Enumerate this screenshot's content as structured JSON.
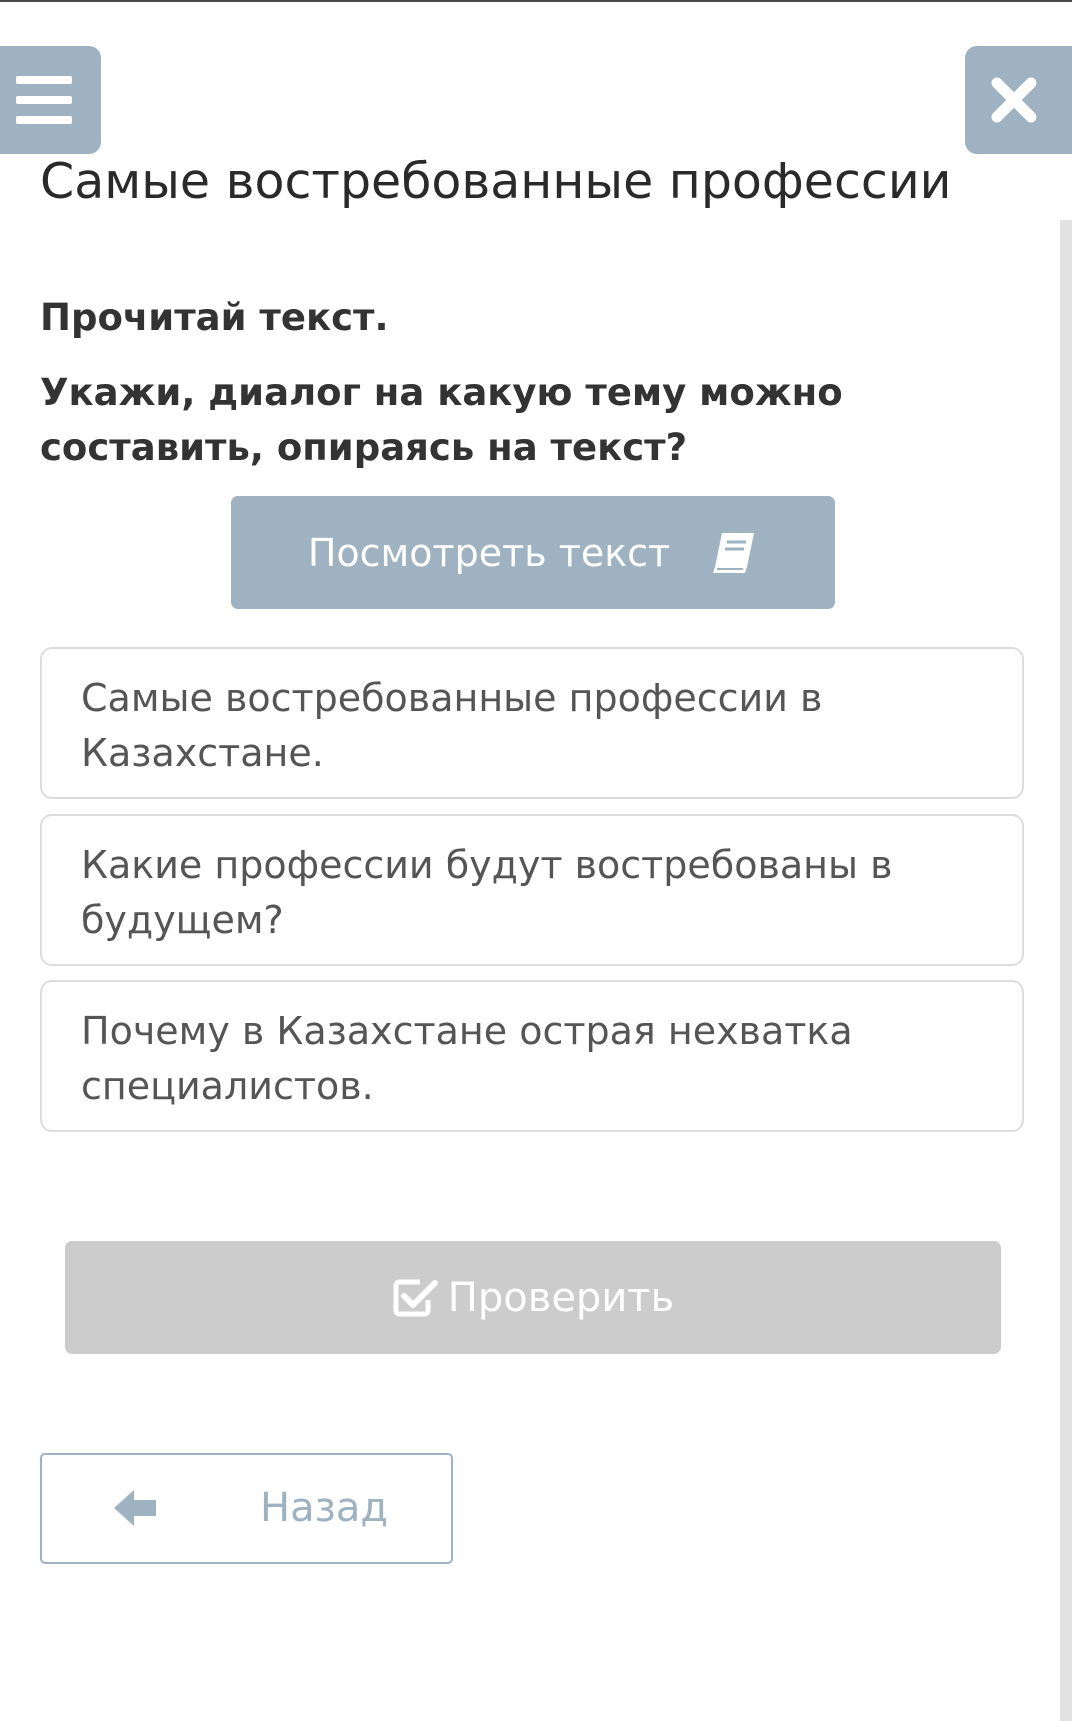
{
  "header": {
    "menu_icon": "hamburger-menu-icon",
    "close_icon": "close-x-icon",
    "title": "Самые востребованные профессии"
  },
  "task": {
    "instruction_1": "Прочитай текст.",
    "instruction_2": "Укажи, диалог на какую тему можно составить, опираясь на текст?",
    "view_text_label": "Посмотреть текст",
    "view_text_icon": "book-icon"
  },
  "options": [
    {
      "label": "Самые востребованные профессии в Казахстане."
    },
    {
      "label": "Какие профессии будут востребованы в будущем?"
    },
    {
      "label": "Почему в Казахстане острая нехватка специалистов."
    }
  ],
  "actions": {
    "check_label": "Проверить",
    "check_icon": "checkbox-check-icon",
    "back_label": "Назад",
    "back_icon": "arrow-left-icon"
  },
  "colors": {
    "accent": "#9eb2c1",
    "disabled": "#cccccc",
    "title_text": "#2a2a2a",
    "body_text": "#555555",
    "card_border": "#dcdcdc"
  }
}
